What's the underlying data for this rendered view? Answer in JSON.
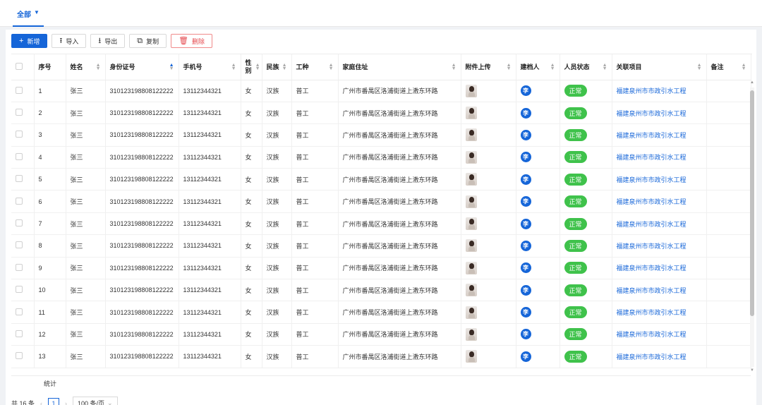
{
  "tabs": {
    "all_label": "全部"
  },
  "toolbar": {
    "add_label": "新增",
    "import_label": "导入",
    "export_label": "导出",
    "copy_label": "复制",
    "delete_label": "删除"
  },
  "table": {
    "headers": {
      "seq": "序号",
      "name": "姓名",
      "id_card": "身份证号",
      "phone": "手机号",
      "gender": "性别",
      "ethnicity": "民族",
      "job": "工种",
      "address": "家庭住址",
      "attachment": "附件上传",
      "creator": "建档人",
      "status": "人员状态",
      "project": "关联项目",
      "remark": "备注"
    },
    "rows": [
      {
        "seq": "1",
        "name": "张三",
        "id_card": "310123198808122222",
        "phone": "13112344321",
        "gender": "女",
        "ethnicity": "汉族",
        "job": "普工",
        "address": "广州市番禺区洛浦街道上漖东环路",
        "creator": "李",
        "status": "正常",
        "project": "福建泉州市市政引水工程"
      },
      {
        "seq": "2",
        "name": "张三",
        "id_card": "310123198808122222",
        "phone": "13112344321",
        "gender": "女",
        "ethnicity": "汉族",
        "job": "普工",
        "address": "广州市番禺区洛浦街道上漖东环路",
        "creator": "李",
        "status": "正常",
        "project": "福建泉州市市政引水工程"
      },
      {
        "seq": "3",
        "name": "张三",
        "id_card": "310123198808122222",
        "phone": "13112344321",
        "gender": "女",
        "ethnicity": "汉族",
        "job": "普工",
        "address": "广州市番禺区洛浦街道上漖东环路",
        "creator": "李",
        "status": "正常",
        "project": "福建泉州市市政引水工程"
      },
      {
        "seq": "4",
        "name": "张三",
        "id_card": "310123198808122222",
        "phone": "13112344321",
        "gender": "女",
        "ethnicity": "汉族",
        "job": "普工",
        "address": "广州市番禺区洛浦街道上漖东环路",
        "creator": "李",
        "status": "正常",
        "project": "福建泉州市市政引水工程"
      },
      {
        "seq": "5",
        "name": "张三",
        "id_card": "310123198808122222",
        "phone": "13112344321",
        "gender": "女",
        "ethnicity": "汉族",
        "job": "普工",
        "address": "广州市番禺区洛浦街道上漖东环路",
        "creator": "李",
        "status": "正常",
        "project": "福建泉州市市政引水工程"
      },
      {
        "seq": "6",
        "name": "张三",
        "id_card": "310123198808122222",
        "phone": "13112344321",
        "gender": "女",
        "ethnicity": "汉族",
        "job": "普工",
        "address": "广州市番禺区洛浦街道上漖东环路",
        "creator": "李",
        "status": "正常",
        "project": "福建泉州市市政引水工程"
      },
      {
        "seq": "7",
        "name": "张三",
        "id_card": "310123198808122222",
        "phone": "13112344321",
        "gender": "女",
        "ethnicity": "汉族",
        "job": "普工",
        "address": "广州市番禺区洛浦街道上漖东环路",
        "creator": "李",
        "status": "正常",
        "project": "福建泉州市市政引水工程"
      },
      {
        "seq": "8",
        "name": "张三",
        "id_card": "310123198808122222",
        "phone": "13112344321",
        "gender": "女",
        "ethnicity": "汉族",
        "job": "普工",
        "address": "广州市番禺区洛浦街道上漖东环路",
        "creator": "李",
        "status": "正常",
        "project": "福建泉州市市政引水工程"
      },
      {
        "seq": "9",
        "name": "张三",
        "id_card": "310123198808122222",
        "phone": "13112344321",
        "gender": "女",
        "ethnicity": "汉族",
        "job": "普工",
        "address": "广州市番禺区洛浦街道上漖东环路",
        "creator": "李",
        "status": "正常",
        "project": "福建泉州市市政引水工程"
      },
      {
        "seq": "10",
        "name": "张三",
        "id_card": "310123198808122222",
        "phone": "13112344321",
        "gender": "女",
        "ethnicity": "汉族",
        "job": "普工",
        "address": "广州市番禺区洛浦街道上漖东环路",
        "creator": "李",
        "status": "正常",
        "project": "福建泉州市市政引水工程"
      },
      {
        "seq": "11",
        "name": "张三",
        "id_card": "310123198808122222",
        "phone": "13112344321",
        "gender": "女",
        "ethnicity": "汉族",
        "job": "普工",
        "address": "广州市番禺区洛浦街道上漖东环路",
        "creator": "李",
        "status": "正常",
        "project": "福建泉州市市政引水工程"
      },
      {
        "seq": "12",
        "name": "张三",
        "id_card": "310123198808122222",
        "phone": "13112344321",
        "gender": "女",
        "ethnicity": "汉族",
        "job": "普工",
        "address": "广州市番禺区洛浦街道上漖东环路",
        "creator": "李",
        "status": "正常",
        "project": "福建泉州市市政引水工程"
      },
      {
        "seq": "13",
        "name": "张三",
        "id_card": "310123198808122222",
        "phone": "13112344321",
        "gender": "女",
        "ethnicity": "汉族",
        "job": "普工",
        "address": "广州市番禺区洛浦街道上漖东环路",
        "creator": "李",
        "status": "正常",
        "project": "福建泉州市市政引水工程"
      }
    ],
    "summary_label": "统计"
  },
  "pagination": {
    "total_label": "共 16 条",
    "current_page": "1",
    "page_size_label": "100 条/页"
  },
  "colors": {
    "accent": "#1565d8",
    "status_green": "#3fc24b",
    "danger": "#e5484d"
  }
}
